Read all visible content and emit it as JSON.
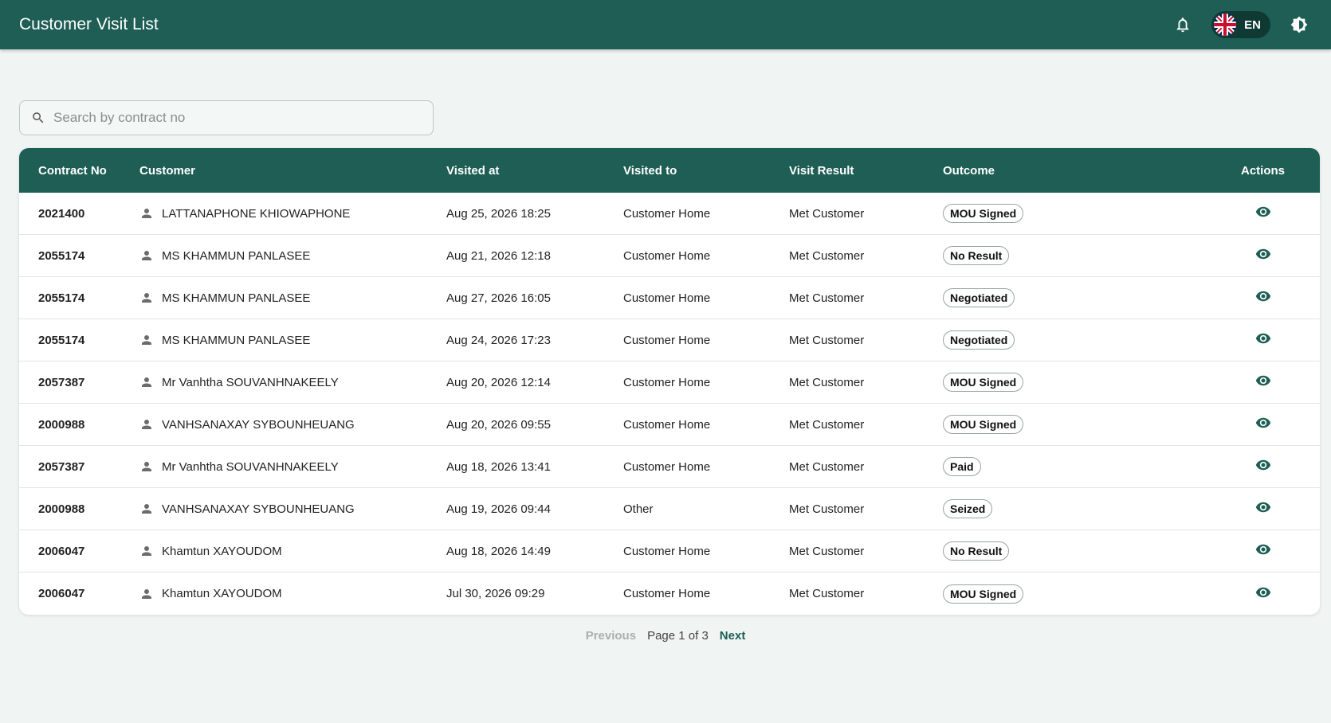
{
  "header": {
    "title": "Customer Visit List",
    "lang_code": "EN"
  },
  "search": {
    "placeholder": "Search by contract no",
    "value": ""
  },
  "table": {
    "columns": [
      "Contract No",
      "Customer",
      "Visited at",
      "Visited to",
      "Visit Result",
      "Outcome",
      "Actions"
    ],
    "rows": [
      {
        "contract": "2021400",
        "customer": "LATTANAPHONE KHIOWAPHONE",
        "visited_at": "Aug 25, 2026 18:25",
        "visited_to": "Customer Home",
        "result": "Met Customer",
        "outcome": "MOU Signed"
      },
      {
        "contract": "2055174",
        "customer": "MS KHAMMUN PANLASEE",
        "visited_at": "Aug 21, 2026 12:18",
        "visited_to": "Customer Home",
        "result": "Met Customer",
        "outcome": "No Result"
      },
      {
        "contract": "2055174",
        "customer": "MS KHAMMUN PANLASEE",
        "visited_at": "Aug 27, 2026 16:05",
        "visited_to": "Customer Home",
        "result": "Met Customer",
        "outcome": "Negotiated"
      },
      {
        "contract": "2055174",
        "customer": "MS KHAMMUN PANLASEE",
        "visited_at": "Aug 24, 2026 17:23",
        "visited_to": "Customer Home",
        "result": "Met Customer",
        "outcome": "Negotiated"
      },
      {
        "contract": "2057387",
        "customer": "Mr Vanhtha SOUVANHNAKEELY",
        "visited_at": "Aug 20, 2026 12:14",
        "visited_to": "Customer Home",
        "result": "Met Customer",
        "outcome": "MOU Signed"
      },
      {
        "contract": "2000988",
        "customer": "VANHSANAXAY SYBOUNHEUANG",
        "visited_at": "Aug 20, 2026 09:55",
        "visited_to": "Customer Home",
        "result": "Met Customer",
        "outcome": "MOU Signed"
      },
      {
        "contract": "2057387",
        "customer": "Mr Vanhtha SOUVANHNAKEELY",
        "visited_at": "Aug 18, 2026 13:41",
        "visited_to": "Customer Home",
        "result": "Met Customer",
        "outcome": "Paid"
      },
      {
        "contract": "2000988",
        "customer": "VANHSANAXAY SYBOUNHEUANG",
        "visited_at": "Aug 19, 2026 09:44",
        "visited_to": "Other",
        "result": "Met Customer",
        "outcome": "Seized"
      },
      {
        "contract": "2006047",
        "customer": "Khamtun XAYOUDOM",
        "visited_at": "Aug 18, 2026 14:49",
        "visited_to": "Customer Home",
        "result": "Met Customer",
        "outcome": "No Result"
      },
      {
        "contract": "2006047",
        "customer": "Khamtun XAYOUDOM",
        "visited_at": "Jul 30, 2026 09:29",
        "visited_to": "Customer Home",
        "result": "Met Customer",
        "outcome": "MOU Signed"
      }
    ]
  },
  "pagination": {
    "prev_label": "Previous",
    "info": "Page 1 of 3",
    "next_label": "Next"
  },
  "icons": {
    "bell": "bell-icon",
    "flag": "uk-flag-icon",
    "theme": "brightness-icon",
    "search": "search-icon",
    "person": "person-icon",
    "view": "eye-icon"
  },
  "colors": {
    "primary": "#1e5e55",
    "background": "#f0f5f3"
  }
}
